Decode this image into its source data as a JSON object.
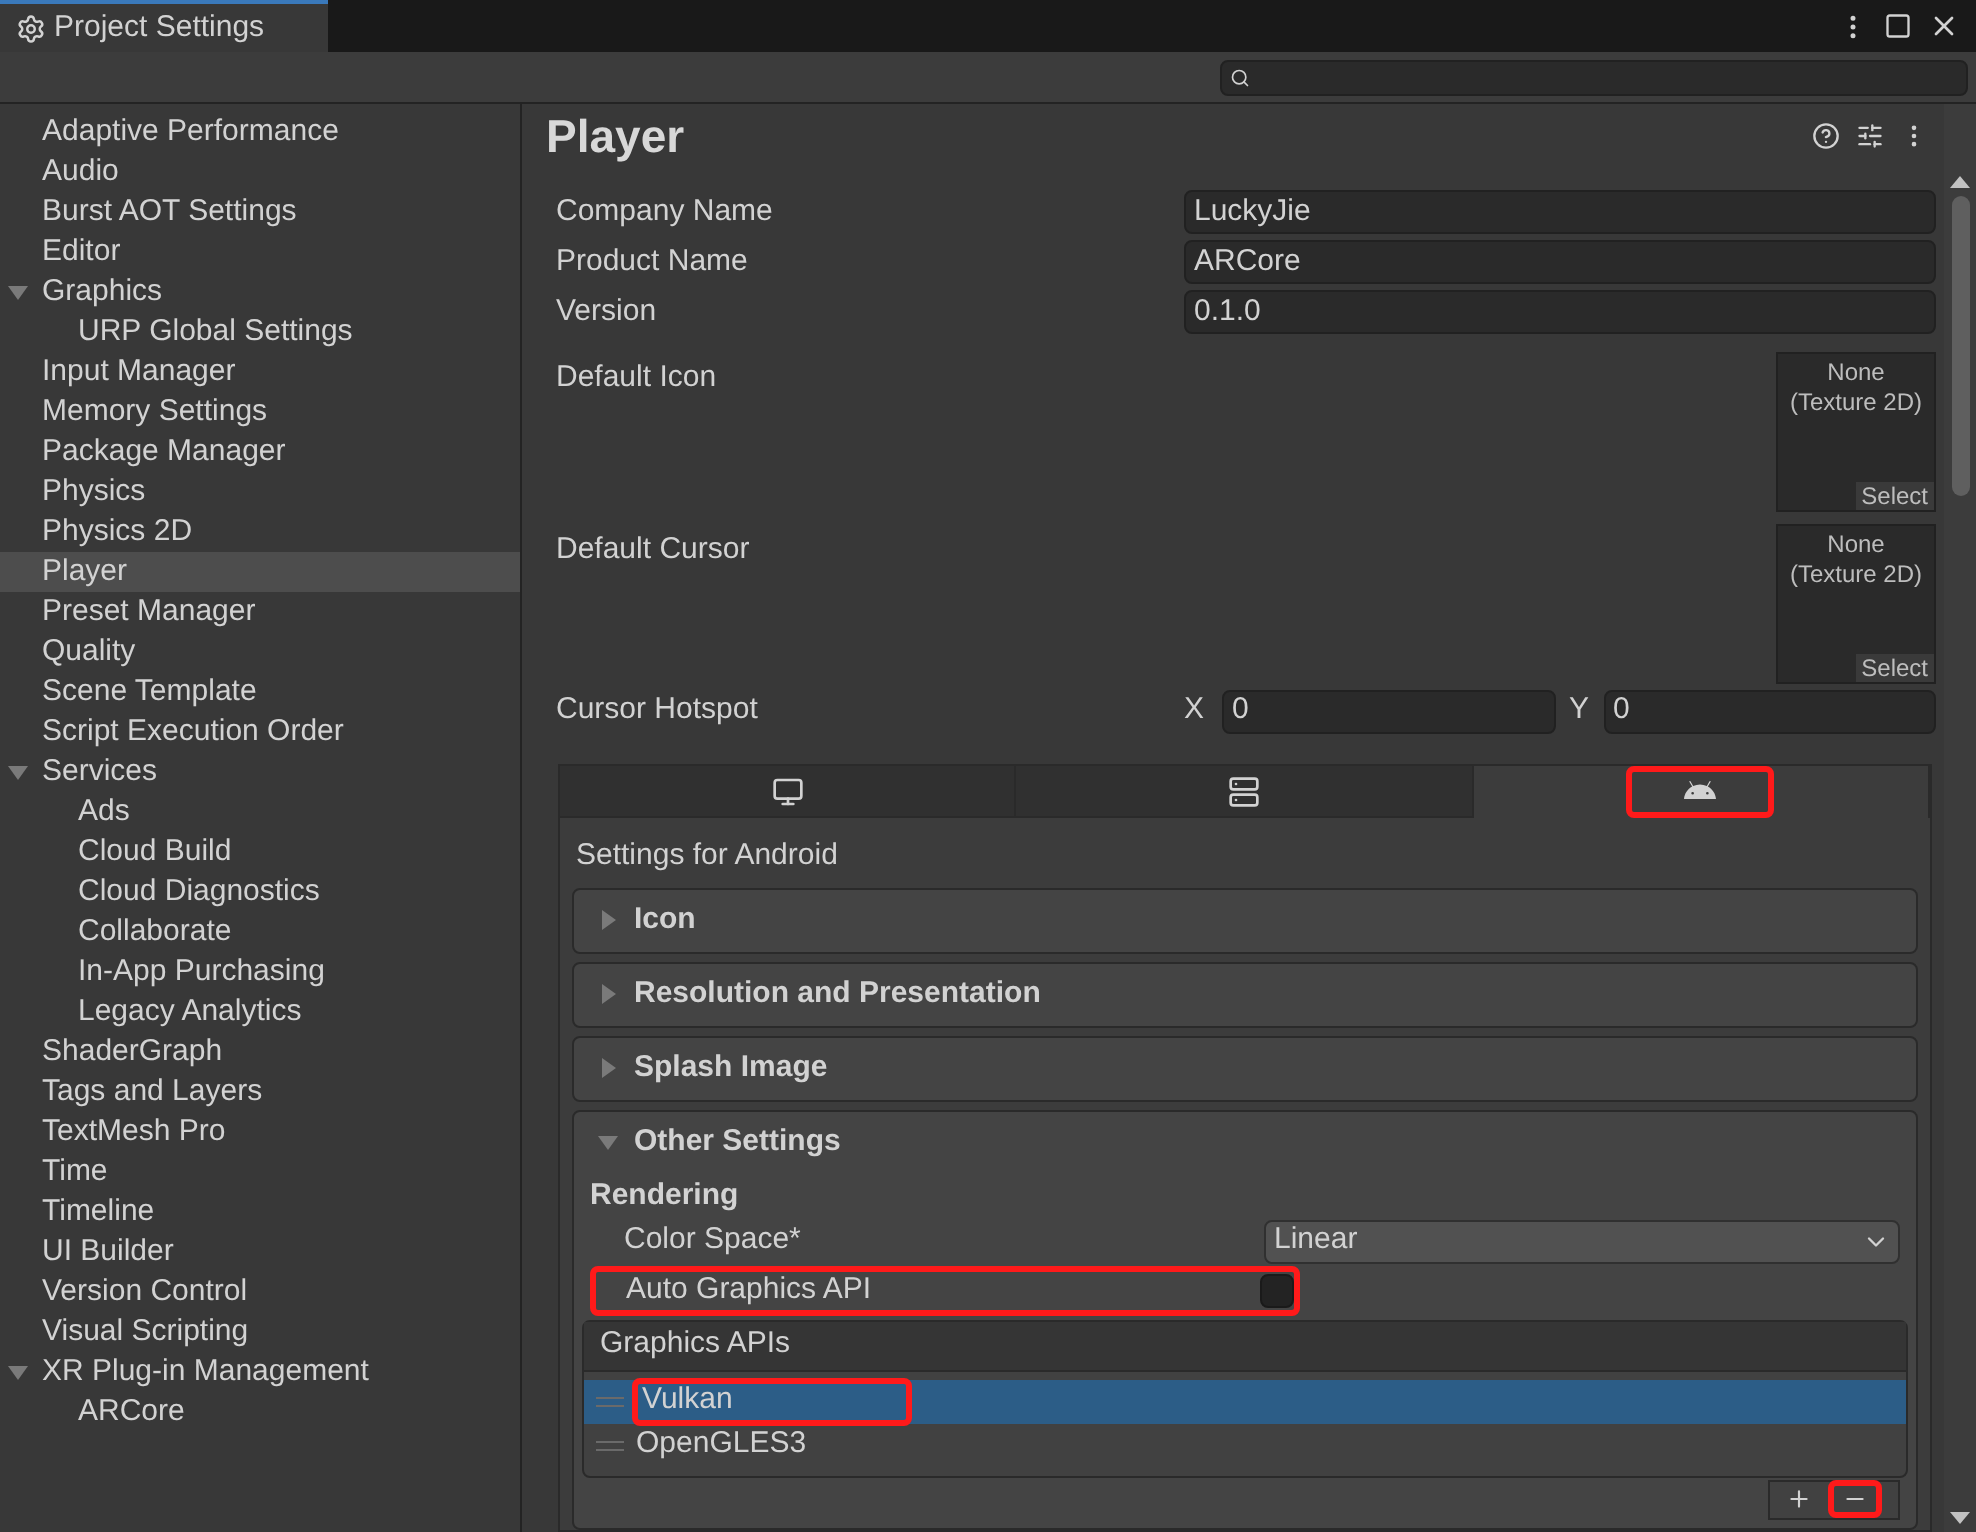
{
  "window": {
    "title": "Project Settings"
  },
  "sidebar": {
    "items": [
      {
        "label": "Adaptive Performance",
        "selected": false
      },
      {
        "label": "Audio",
        "selected": false
      },
      {
        "label": "Burst AOT Settings",
        "selected": false
      },
      {
        "label": "Editor",
        "selected": false
      },
      {
        "label": "Graphics",
        "selected": false,
        "expanded": true,
        "children": [
          {
            "label": "URP Global Settings",
            "selected": false
          }
        ]
      },
      {
        "label": "Input Manager",
        "selected": false
      },
      {
        "label": "Memory Settings",
        "selected": false
      },
      {
        "label": "Package Manager",
        "selected": false
      },
      {
        "label": "Physics",
        "selected": false
      },
      {
        "label": "Physics 2D",
        "selected": false
      },
      {
        "label": "Player",
        "selected": true
      },
      {
        "label": "Preset Manager",
        "selected": false
      },
      {
        "label": "Quality",
        "selected": false
      },
      {
        "label": "Scene Template",
        "selected": false
      },
      {
        "label": "Script Execution Order",
        "selected": false
      },
      {
        "label": "Services",
        "selected": false,
        "expanded": true,
        "children": [
          {
            "label": "Ads",
            "selected": false
          },
          {
            "label": "Cloud Build",
            "selected": false
          },
          {
            "label": "Cloud Diagnostics",
            "selected": false
          },
          {
            "label": "Collaborate",
            "selected": false
          },
          {
            "label": "In-App Purchasing",
            "selected": false
          },
          {
            "label": "Legacy Analytics",
            "selected": false
          }
        ]
      },
      {
        "label": "ShaderGraph",
        "selected": false
      },
      {
        "label": "Tags and Layers",
        "selected": false
      },
      {
        "label": "TextMesh Pro",
        "selected": false
      },
      {
        "label": "Time",
        "selected": false
      },
      {
        "label": "Timeline",
        "selected": false
      },
      {
        "label": "UI Builder",
        "selected": false
      },
      {
        "label": "Version Control",
        "selected": false
      },
      {
        "label": "Visual Scripting",
        "selected": false
      },
      {
        "label": "XR Plug-in Management",
        "selected": false,
        "expanded": true,
        "children": [
          {
            "label": "ARCore",
            "selected": false
          }
        ]
      }
    ]
  },
  "panel": {
    "title": "Player",
    "fields": [
      {
        "label": "Company Name",
        "value": "LuckyJie"
      },
      {
        "label": "Product Name",
        "value": "ARCore"
      },
      {
        "label": "Version",
        "value": "0.1.0"
      }
    ],
    "object_fields": [
      {
        "label": "Default Icon",
        "value": "None\n(Texture 2D)",
        "button": "Select"
      },
      {
        "label": "Default Cursor",
        "value": "None\n(Texture 2D)",
        "button": "Select"
      }
    ],
    "hotspot": {
      "label": "Cursor Hotspot",
      "x_label": "X",
      "x_value": "0",
      "y_label": "Y",
      "y_value": "0"
    },
    "platform_tabs": [
      {
        "kind": "desktop",
        "selected": false,
        "highlighted": false
      },
      {
        "kind": "server",
        "selected": false,
        "highlighted": false
      },
      {
        "kind": "android",
        "selected": true,
        "highlighted": true
      }
    ],
    "platform_heading": "Settings for Android",
    "sections": [
      {
        "label": "Icon",
        "expanded": false
      },
      {
        "label": "Resolution and Presentation",
        "expanded": false
      },
      {
        "label": "Splash Image",
        "expanded": false
      },
      {
        "label": "Other Settings",
        "expanded": true
      }
    ],
    "rendering": {
      "heading": "Rendering",
      "color_space": {
        "label": "Color Space*",
        "value": "Linear"
      },
      "auto_graphics": {
        "label": "Auto Graphics API",
        "checked": false,
        "highlighted": true
      }
    },
    "graphics_apis": {
      "heading": "Graphics APIs",
      "items": [
        {
          "label": "Vulkan",
          "selected": true,
          "highlighted": true
        },
        {
          "label": "OpenGLES3",
          "selected": false,
          "highlighted": false
        }
      ],
      "remove_highlighted": true
    }
  }
}
